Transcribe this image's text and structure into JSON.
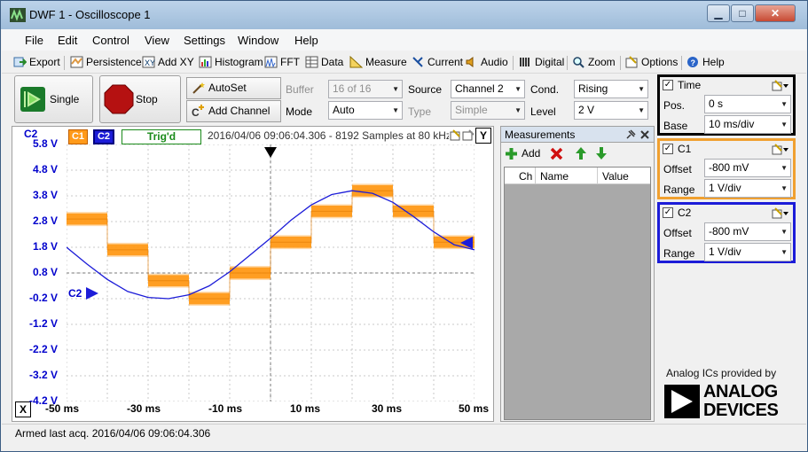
{
  "window": {
    "title": "DWF 1 - Oscilloscope 1"
  },
  "menu": [
    "File",
    "Edit",
    "Control",
    "View",
    "Settings",
    "Window",
    "Help"
  ],
  "toolbar": {
    "export": "Export",
    "persistence": "Persistence",
    "add_xy": "Add XY",
    "histogram": "Histogram",
    "fft": "FFT",
    "data": "Data",
    "measure": "Measure",
    "current": "Current",
    "audio": "Audio",
    "digital": "Digital",
    "zoom": "Zoom",
    "options": "Options",
    "help": "Help"
  },
  "controls": {
    "single": "Single",
    "stop": "Stop",
    "autoset": "AutoSet",
    "add_channel": "Add Channel",
    "buffer_label": "Buffer",
    "buffer_value": "16 of 16",
    "mode_label": "Mode",
    "mode_value": "Auto",
    "source_label": "Source",
    "source_value": "Channel 2",
    "type_label": "Type",
    "type_value": "Simple",
    "cond_label": "Cond.",
    "cond_value": "Rising",
    "level_label": "Level",
    "level_value": "2 V"
  },
  "plot": {
    "c1_tag": "C1",
    "c2_tag": "C2",
    "status": "Trig'd",
    "info": "2016/04/06 09:06:04.306 - 8192 Samples at 80 kHz",
    "y_axis_title": "C2",
    "y_btn": "Y",
    "x_btn": "X",
    "c2_marker": "C2",
    "colors": {
      "c1": "#ff9a1a",
      "c2": "#1c1cd8"
    }
  },
  "measurements": {
    "title": "Measurements",
    "add": "Add",
    "cols": [
      "Ch",
      "Name",
      "Value"
    ]
  },
  "time": {
    "title": "Time",
    "pos_label": "Pos.",
    "pos_value": "0 s",
    "base_label": "Base",
    "base_value": "10 ms/div"
  },
  "c1": {
    "title": "C1",
    "offset_label": "Offset",
    "offset_value": "-800 mV",
    "range_label": "Range",
    "range_value": "1 V/div"
  },
  "c2": {
    "title": "C2",
    "offset_label": "Offset",
    "offset_value": "-800 mV",
    "range_label": "Range",
    "range_value": "1 V/div"
  },
  "branding": {
    "line1": "Analog ICs provided by",
    "brand1": "ANALOG",
    "brand2": "DEVICES"
  },
  "status": "Armed last acq. 2016/04/06  09:06:04.306",
  "chart_data": {
    "type": "line",
    "ylabel": "C2",
    "y_ticks": [
      "5.8 V",
      "4.8 V",
      "3.8 V",
      "2.8 V",
      "1.8 V",
      "0.8 V",
      "-0.2 V",
      "-1.2 V",
      "-2.2 V",
      "-3.2 V",
      "-4.2 V"
    ],
    "x_ticks": [
      "-50 ms",
      "-30 ms",
      "-10 ms",
      "10 ms",
      "30 ms",
      "50 ms"
    ],
    "xlim": [
      -50,
      50
    ],
    "ylim": [
      -4.2,
      5.8
    ],
    "grid": true,
    "series": [
      {
        "name": "C1",
        "x": [
          -50,
          -40,
          -40,
          -30,
          -30,
          -20,
          -20,
          -10,
          -10,
          0,
          0,
          10,
          10,
          20,
          20,
          30,
          30,
          40,
          40,
          50
        ],
        "values": [
          2.9,
          2.9,
          1.7,
          1.7,
          0.5,
          0.5,
          -0.2,
          -0.2,
          0.8,
          0.8,
          2.0,
          2.0,
          3.2,
          3.2,
          4.0,
          4.0,
          3.2,
          3.2,
          2.0,
          2.0
        ],
        "band": 0.55
      },
      {
        "name": "C2",
        "x": [
          -50,
          -45,
          -40,
          -35,
          -30,
          -25,
          -20,
          -15,
          -10,
          -5,
          0,
          5,
          10,
          15,
          20,
          25,
          30,
          35,
          40,
          45,
          50
        ],
        "values": [
          1.8,
          1.15,
          0.55,
          0.08,
          -0.15,
          -0.2,
          -0.05,
          0.3,
          0.85,
          1.5,
          2.15,
          2.85,
          3.45,
          3.85,
          4.0,
          3.9,
          3.55,
          3.0,
          2.4,
          1.9,
          1.7
        ]
      }
    ]
  }
}
